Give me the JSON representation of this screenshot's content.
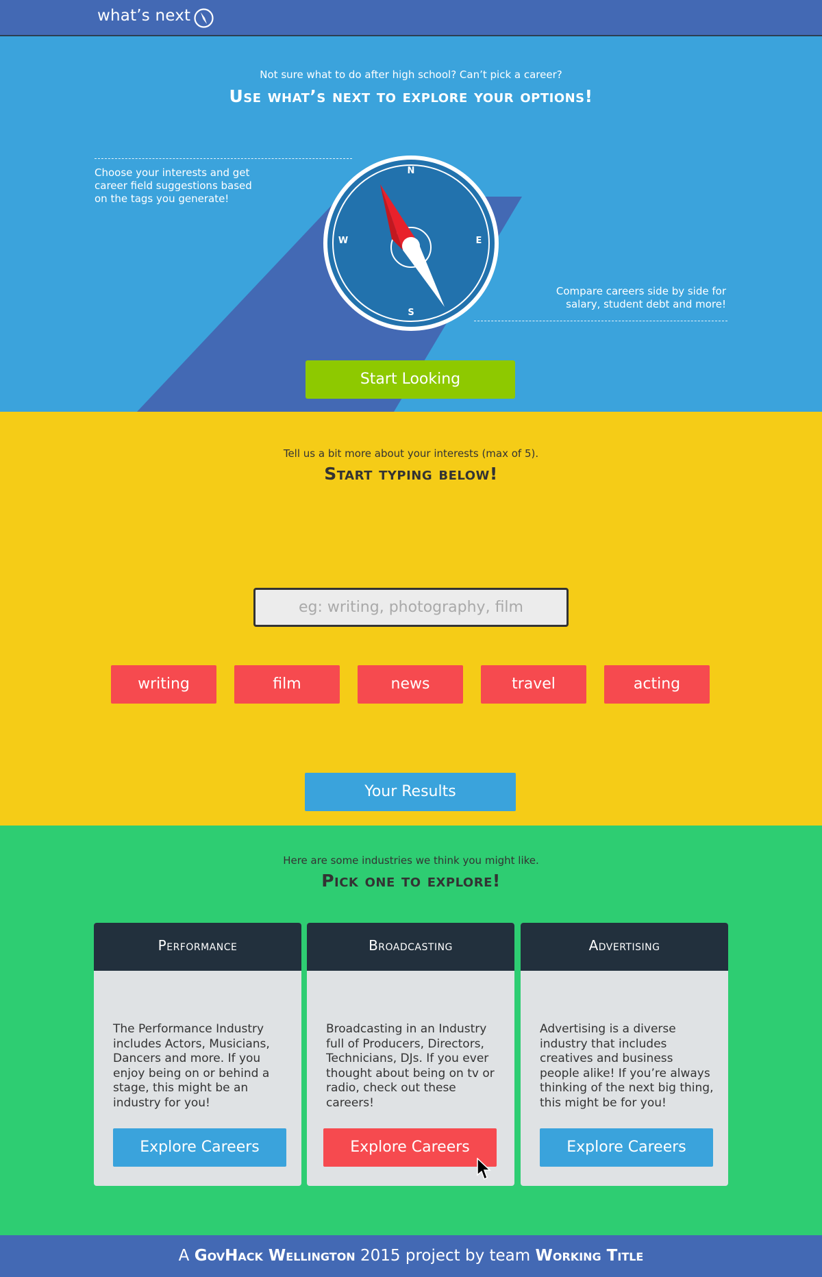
{
  "nav": {
    "brand": "what’s next"
  },
  "hero": {
    "subtitle": "Not sure what to do after high school? Can’t pick a career?",
    "title_prefix": "Use ",
    "title_bold": "what’s next",
    "title_suffix": " to explore your options!",
    "note_left": "Choose your interests and get career field suggestions based on the tags you generate!",
    "note_right": "Compare careers side by side for salary, student debt and more!",
    "compass_labels": {
      "n": "N",
      "e": "E",
      "s": "S",
      "w": "W"
    },
    "start_button": "Start Looking",
    "colors": {
      "background": "#3ba3dc",
      "shadow": "#4369b4",
      "button": "#8ec900",
      "needle": "#e8212b"
    }
  },
  "interests": {
    "subtitle": "Tell us a bit more about your interests (max of 5).",
    "title": "Start typing below!",
    "input": {
      "value": "",
      "placeholder": "eg: writing, photography, film"
    },
    "tags": [
      "writing",
      "film",
      "news",
      "travel",
      "acting"
    ],
    "results_button": "Your Results",
    "colors": {
      "background": "#f5cc17",
      "tag": "#f64a4f"
    }
  },
  "industries": {
    "subtitle": "Here are some industries we think you might like.",
    "title": "Pick one to explore!",
    "cards": [
      {
        "title": "Performance",
        "description": "The Performance Industry includes Actors, Musicians, Dancers and more. If you enjoy being on or behind a stage, this might be an industry for you!",
        "button": "Explore Careers"
      },
      {
        "title": "Broadcasting",
        "description": "Broadcasting in an Industry full of Producers, Directors, Technicians, DJs. If you ever thought about being on tv or radio, check out these careers!",
        "button": "Explore Careers"
      },
      {
        "title": "Advertising",
        "description": "Advertising is a diverse industry that includes creatives and business people alike! If you’re always thinking of the next big thing, this might be for you!",
        "button": "Explore Careers"
      }
    ],
    "colors": {
      "background": "#2ecd72",
      "card_header": "#22303d",
      "button": "#3aa3dc",
      "button_hover": "#f64a4f"
    }
  },
  "footer": {
    "prefix": "A ",
    "event": "GovHack Wellington",
    "middle": " 2015 project by team ",
    "team": "Working Title"
  }
}
